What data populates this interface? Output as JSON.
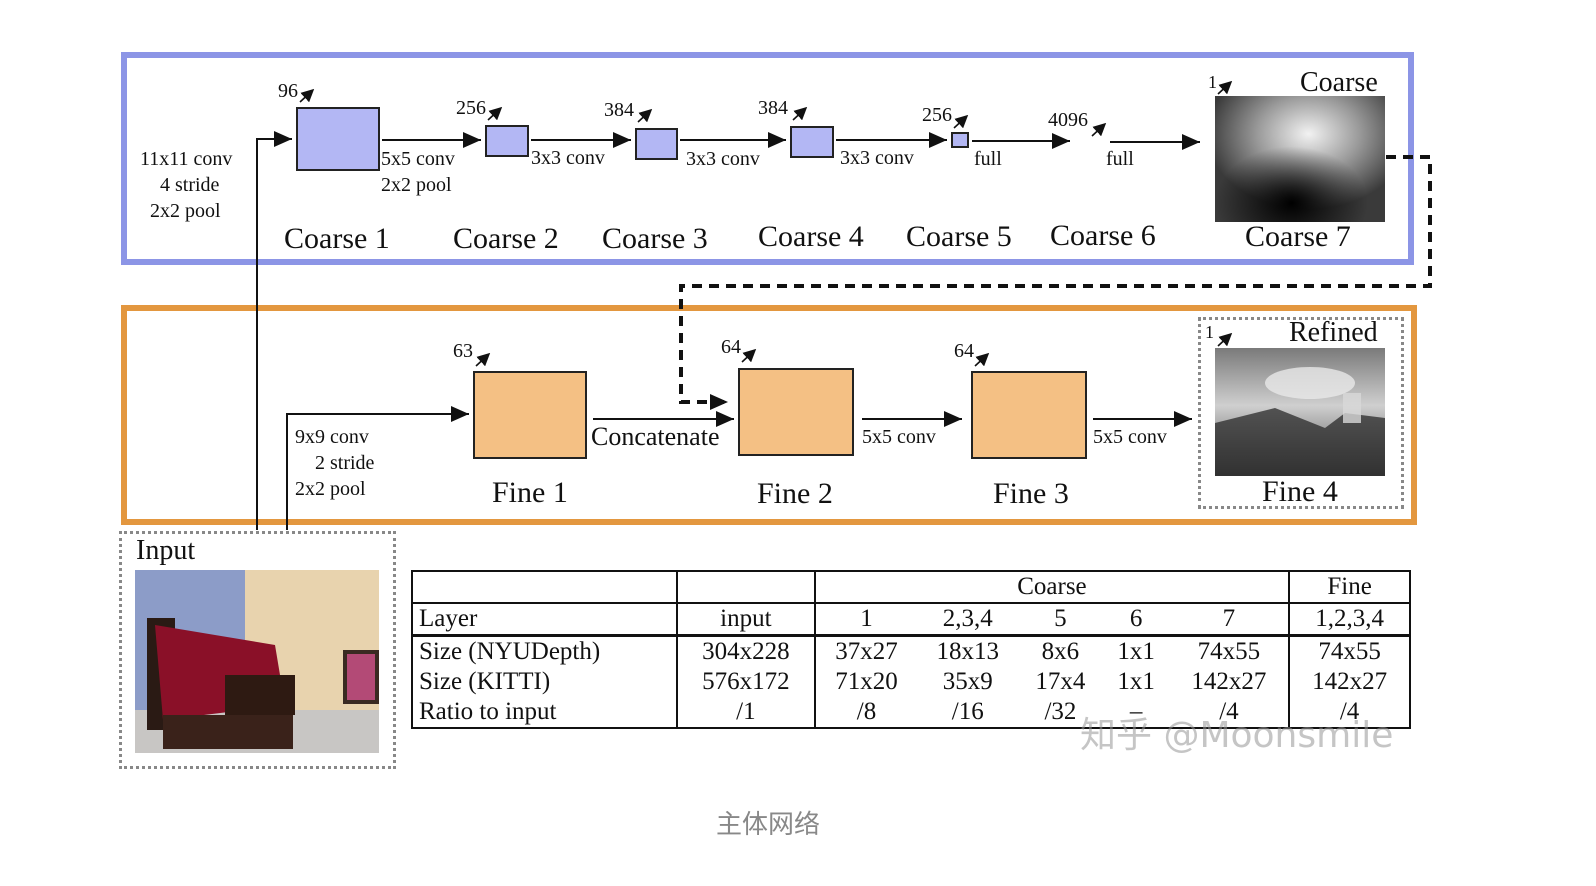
{
  "coarse": {
    "prelude": "11x11 conv\n    4 stride\n  2x2 pool",
    "layers": [
      {
        "label": "Coarse 1",
        "depth": "96",
        "op": "5x5 conv\n2x2 pool"
      },
      {
        "label": "Coarse 2",
        "depth": "256",
        "op": "3x3 conv"
      },
      {
        "label": "Coarse 3",
        "depth": "384",
        "op": "3x3 conv"
      },
      {
        "label": "Coarse 4",
        "depth": "384",
        "op": "3x3 conv"
      },
      {
        "label": "Coarse 5",
        "depth": "256",
        "op": "full"
      },
      {
        "label": "Coarse 6",
        "depth": "4096",
        "op": "full"
      },
      {
        "label": "Coarse 7",
        "depth": "1",
        "title": "Coarse"
      }
    ]
  },
  "fine": {
    "prelude": "9x9 conv\n    2 stride\n2x2 pool",
    "layers": [
      {
        "label": "Fine 1",
        "depth": "63",
        "op": "Concatenate"
      },
      {
        "label": "Fine 2",
        "depth": "64",
        "op": "5x5 conv"
      },
      {
        "label": "Fine 3",
        "depth": "64",
        "op": "5x5 conv"
      },
      {
        "label": "Fine 4",
        "depth": "1",
        "title": "Refined"
      }
    ]
  },
  "input": {
    "label": "Input"
  },
  "table": {
    "group_row": [
      "",
      "",
      "Coarse",
      "Fine"
    ],
    "header": [
      "Layer",
      "input",
      "1",
      "2,3,4",
      "5",
      "6",
      "7",
      "1,2,3,4"
    ],
    "rows": [
      [
        "Size (NYUDepth)",
        "304x228",
        "37x27",
        "18x13",
        "8x6",
        "1x1",
        "74x55",
        "74x55"
      ],
      [
        "Size (KITTI)",
        "576x172",
        "71x20",
        "35x9",
        "17x4",
        "1x1",
        "142x27",
        "142x27"
      ],
      [
        "Ratio to input",
        "/1",
        "/8",
        "/16",
        "/32",
        "–",
        "/4",
        "/4"
      ]
    ]
  },
  "watermark": "知乎 @Moonsmile",
  "caption": "主体网络",
  "colors": {
    "coarse_border": "#8c95e6",
    "fine_border": "#e3973f",
    "coarse_fill": "#b3b7f4",
    "fine_fill": "#f4c084"
  }
}
